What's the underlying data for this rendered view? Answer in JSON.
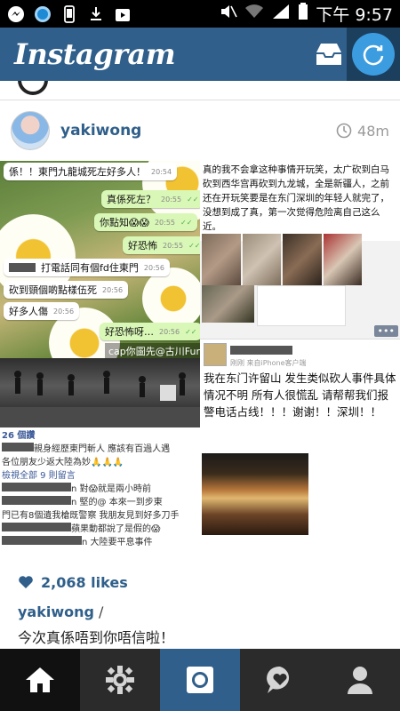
{
  "status_bar": {
    "time": "下午 9:57",
    "icons": [
      "messenger-icon",
      "circle-app-icon",
      "phone-icon",
      "download-icon",
      "play-store-icon"
    ],
    "right_icons": [
      "mute-icon",
      "wifi-icon",
      "signal-icon",
      "battery-icon"
    ]
  },
  "header": {
    "logo": "Instagram",
    "inbox_icon": "inbox-icon",
    "refresh_icon": "refresh-icon",
    "colors": {
      "bar": "#2f5f8a",
      "refresh": "#3b9de0"
    }
  },
  "post": {
    "username": "yakiwong",
    "time_ago": "48m",
    "likes": "2,068 likes",
    "caption_user": "yakiwong",
    "caption_slash": " /",
    "caption": "今次真係唔到你唔信啦！",
    "image": {
      "chat": [
        {
          "text": "係！！東門九龍城死左好多人！",
          "time": "20:54",
          "mine": false
        },
        {
          "text": "真係死左？",
          "time": "20:55",
          "mine": true
        },
        {
          "text": "你點知😱😱",
          "time": "20:55",
          "mine": true
        },
        {
          "text": "好恐怖",
          "time": "20:55",
          "mine": true
        },
        {
          "text": "打電話同有個fd住東門",
          "time": "20:56",
          "mine": false
        },
        {
          "text": "砍到頸個啲點樣伍死",
          "time": "20:56",
          "mine": false
        },
        {
          "text": "好多人傷",
          "time": "20:56",
          "mine": false
        },
        {
          "text": "好恐怖呀…",
          "time": "20:56",
          "mine": true
        },
        {
          "text": "cap你圖先@古川Furukawa-",
          "time": "",
          "mine": true
        }
      ],
      "fb": {
        "count": "26 個讚",
        "line1": "親身經歷東門斬人 應該有百過人遇",
        "line2": "各位朋友少返大陸為妙🙏🙏🙏",
        "view_all": "檢視全部 9 則留言",
        "comment1": "n 對😱就是兩小時前",
        "comment2a": "n 堅的@ 本來一到步東",
        "comment2b": "門已有8個遺我槍既警察 我朋友見到好多刀手",
        "comment3": "蘋果動都說了是假的😱",
        "comment4": "n 大陸要平息事件"
      },
      "weibo_text": "真的我不会拿这种事情开玩笑，太广砍到白马砍到西华宫再砍到九龙城，全是新疆人，之前还在开玩笑要是在东门深圳的年轻人就完了，没想到成了真，第一次觉得危险离自己这么近。",
      "weibo_post": {
        "source": "刚刚  来自iPhone客户端",
        "text": "我在东门许留山 发生类似砍人事件具体情况不明 所有人很慌乱 请帮帮我们报警电话占线！！！谢谢！！深圳！！"
      },
      "more": "•••"
    }
  },
  "bottom_nav": [
    {
      "name": "home",
      "icon": "home-icon",
      "active": true
    },
    {
      "name": "explore",
      "icon": "explore-icon",
      "active": false
    },
    {
      "name": "camera",
      "icon": "camera-icon",
      "active": false
    },
    {
      "name": "activity",
      "icon": "activity-icon",
      "active": false
    },
    {
      "name": "profile",
      "icon": "profile-icon",
      "active": false
    }
  ]
}
